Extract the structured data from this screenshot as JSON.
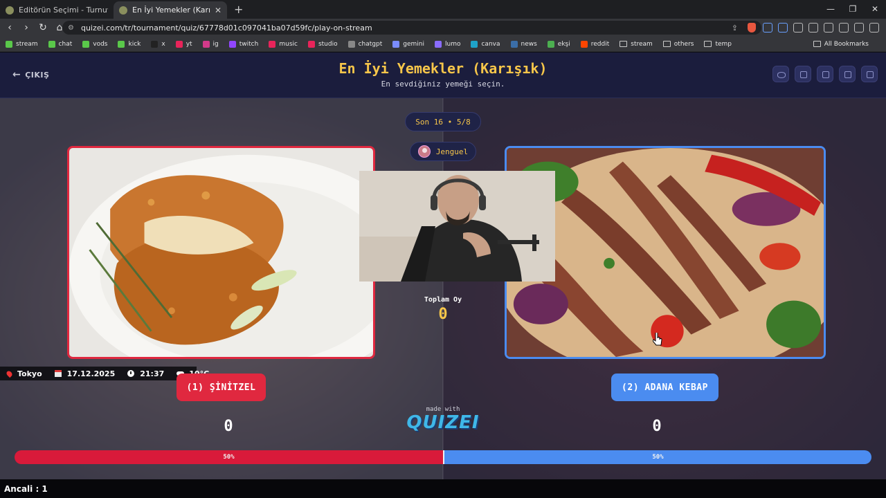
{
  "browser": {
    "tabs": [
      {
        "title": "Editörün Seçimi - Turnuva - Quizei"
      },
      {
        "title": "En İyi Yemekler (Karışık) - Tier List"
      }
    ],
    "url": "quizei.com/tr/tournament/quiz/67778d01c097041ba07d59fc/play-on-stream",
    "bookmarks": [
      "stream",
      "chat",
      "vods",
      "kick",
      "x",
      "yt",
      "ig",
      "twitch",
      "music",
      "studio",
      "chatgpt",
      "gemini",
      "lumo",
      "canva",
      "news",
      "ekşi",
      "reddit",
      "stream",
      "others",
      "temp"
    ],
    "all_bookmarks": "All Bookmarks"
  },
  "header": {
    "exit_label": "ÇIKIŞ",
    "title": "En İyi Yemekler (Karışık)",
    "subtitle": "En sevdiğiniz yemeği seçin."
  },
  "match": {
    "round": "Son 16 • 5/8",
    "username": "Jenguel",
    "total_label": "Toplam Oy",
    "total_value": "0",
    "left": {
      "label": "(1) ŞİNİTZEL",
      "votes": "0",
      "percent_label": "50%",
      "share": 0.5,
      "accent": "#e0283f"
    },
    "right": {
      "label": "(2) ADANA KEBAP",
      "votes": "0",
      "percent_label": "50%",
      "share": 0.5,
      "accent": "#4b8cf0"
    }
  },
  "made_with": "made with",
  "logo_text": "QUIZEI",
  "info": {
    "city": "Tokyo",
    "date": "17.12.2025",
    "time": "21:37",
    "temp": "10°C"
  },
  "footer_text": "Ancali : 1"
}
